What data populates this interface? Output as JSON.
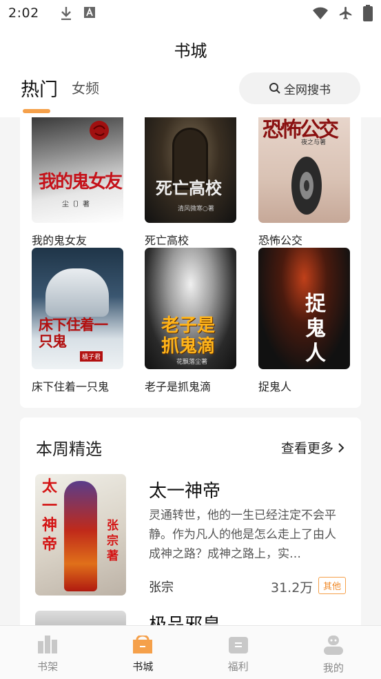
{
  "status_bar": {
    "time": "2:02"
  },
  "header": {
    "title": "书城",
    "tabs": [
      {
        "label": "热门"
      },
      {
        "label": "女频"
      }
    ],
    "search_label": "全网搜书"
  },
  "hot_books": [
    {
      "title": "我的鬼女友",
      "cover_text": "我的鬼女友",
      "cover_author": "尘〔〕著"
    },
    {
      "title": "死亡高校",
      "cover_text": "死亡高校",
      "cover_author": "清风微寒○著"
    },
    {
      "title": "恐怖公交",
      "cover_text": "恐怖公交",
      "cover_author": "夜之与著"
    },
    {
      "title": "床下住着一只鬼",
      "cover_text": "床下住着一只鬼",
      "cover_author": "橘子君"
    },
    {
      "title": "老子是抓鬼滴",
      "cover_text": "老子是抓鬼滴",
      "cover_author": "花飘落尘著"
    },
    {
      "title": "捉鬼人",
      "cover_text": "捉鬼人",
      "cover_author": ""
    }
  ],
  "weekly": {
    "section_title": "本周精选",
    "see_more": "查看更多",
    "featured": {
      "title": "太一神帝",
      "cover_text": "太一神帝",
      "cover_author": "张宗著",
      "description": "灵通转世，他的一生已经注定不会平静。作为凡人的他是怎么走上了由人成神之路？成神之路上，实…",
      "author": "张宗",
      "word_count": "31.2万",
      "badge": "其他"
    },
    "next_title": "极品邪皇"
  },
  "bottom_nav": [
    {
      "label": "书架"
    },
    {
      "label": "书城"
    },
    {
      "label": "福利"
    },
    {
      "label": "我的"
    }
  ],
  "colors": {
    "accent": "#f5a04a",
    "badge": "#f08a2a"
  }
}
